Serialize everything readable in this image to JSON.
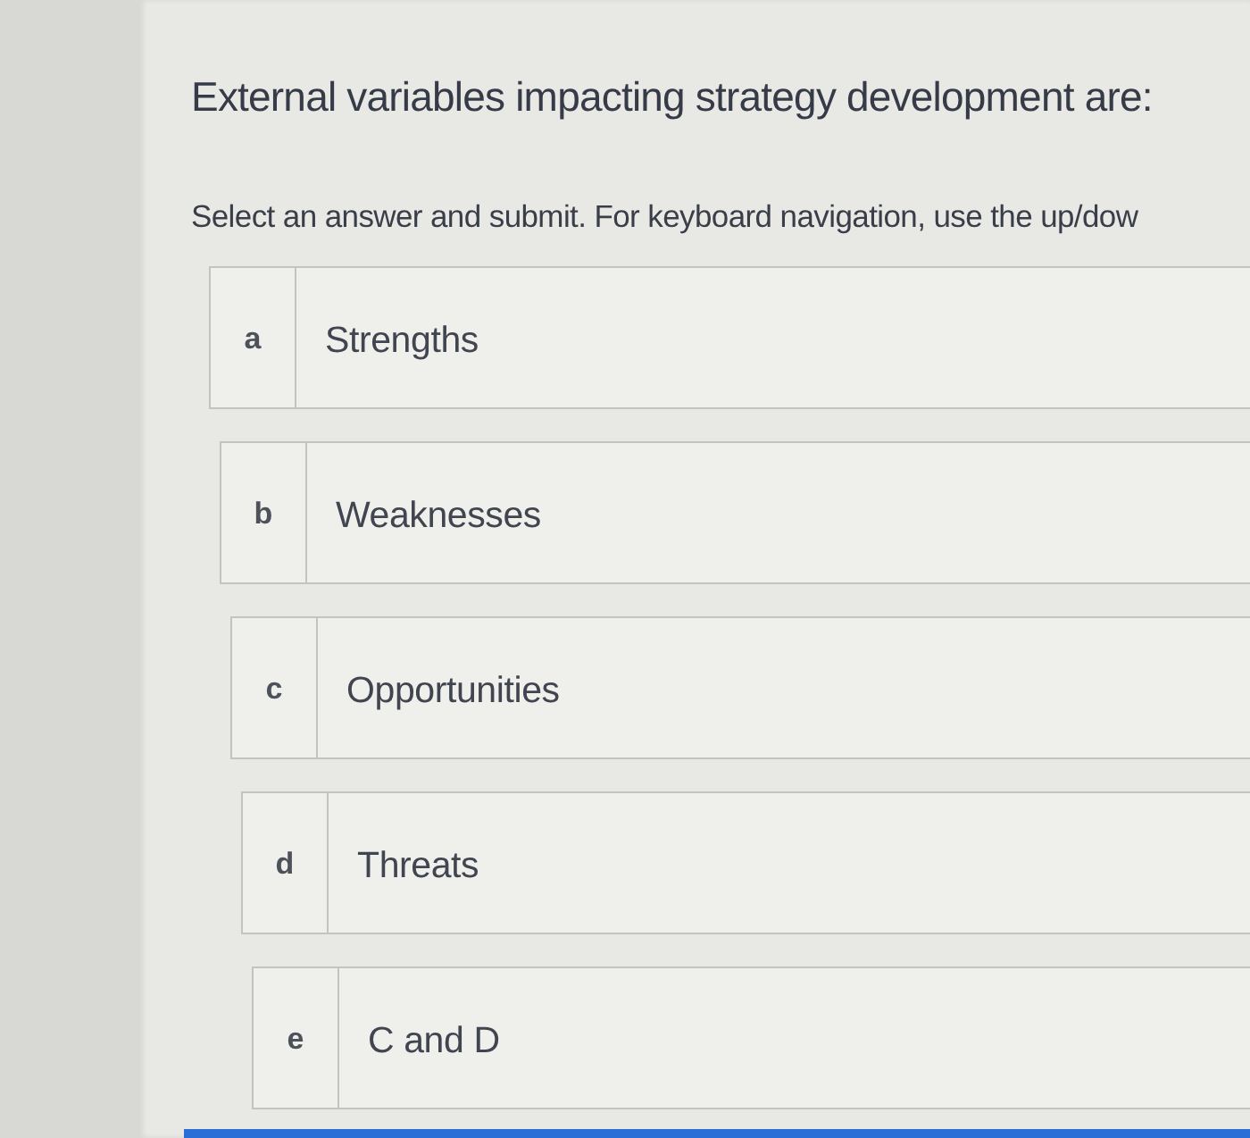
{
  "question": {
    "title": "External variables impacting strategy development are:",
    "instruction": "Select an answer and submit. For keyboard navigation, use the up/dow"
  },
  "options": [
    {
      "letter": "a",
      "text": "Strengths",
      "selected": false
    },
    {
      "letter": "b",
      "text": "Weaknesses",
      "selected": false
    },
    {
      "letter": "c",
      "text": "Opportunities",
      "selected": false
    },
    {
      "letter": "d",
      "text": "Threats",
      "selected": false
    },
    {
      "letter": "e",
      "text": "C and D",
      "selected": false
    }
  ]
}
